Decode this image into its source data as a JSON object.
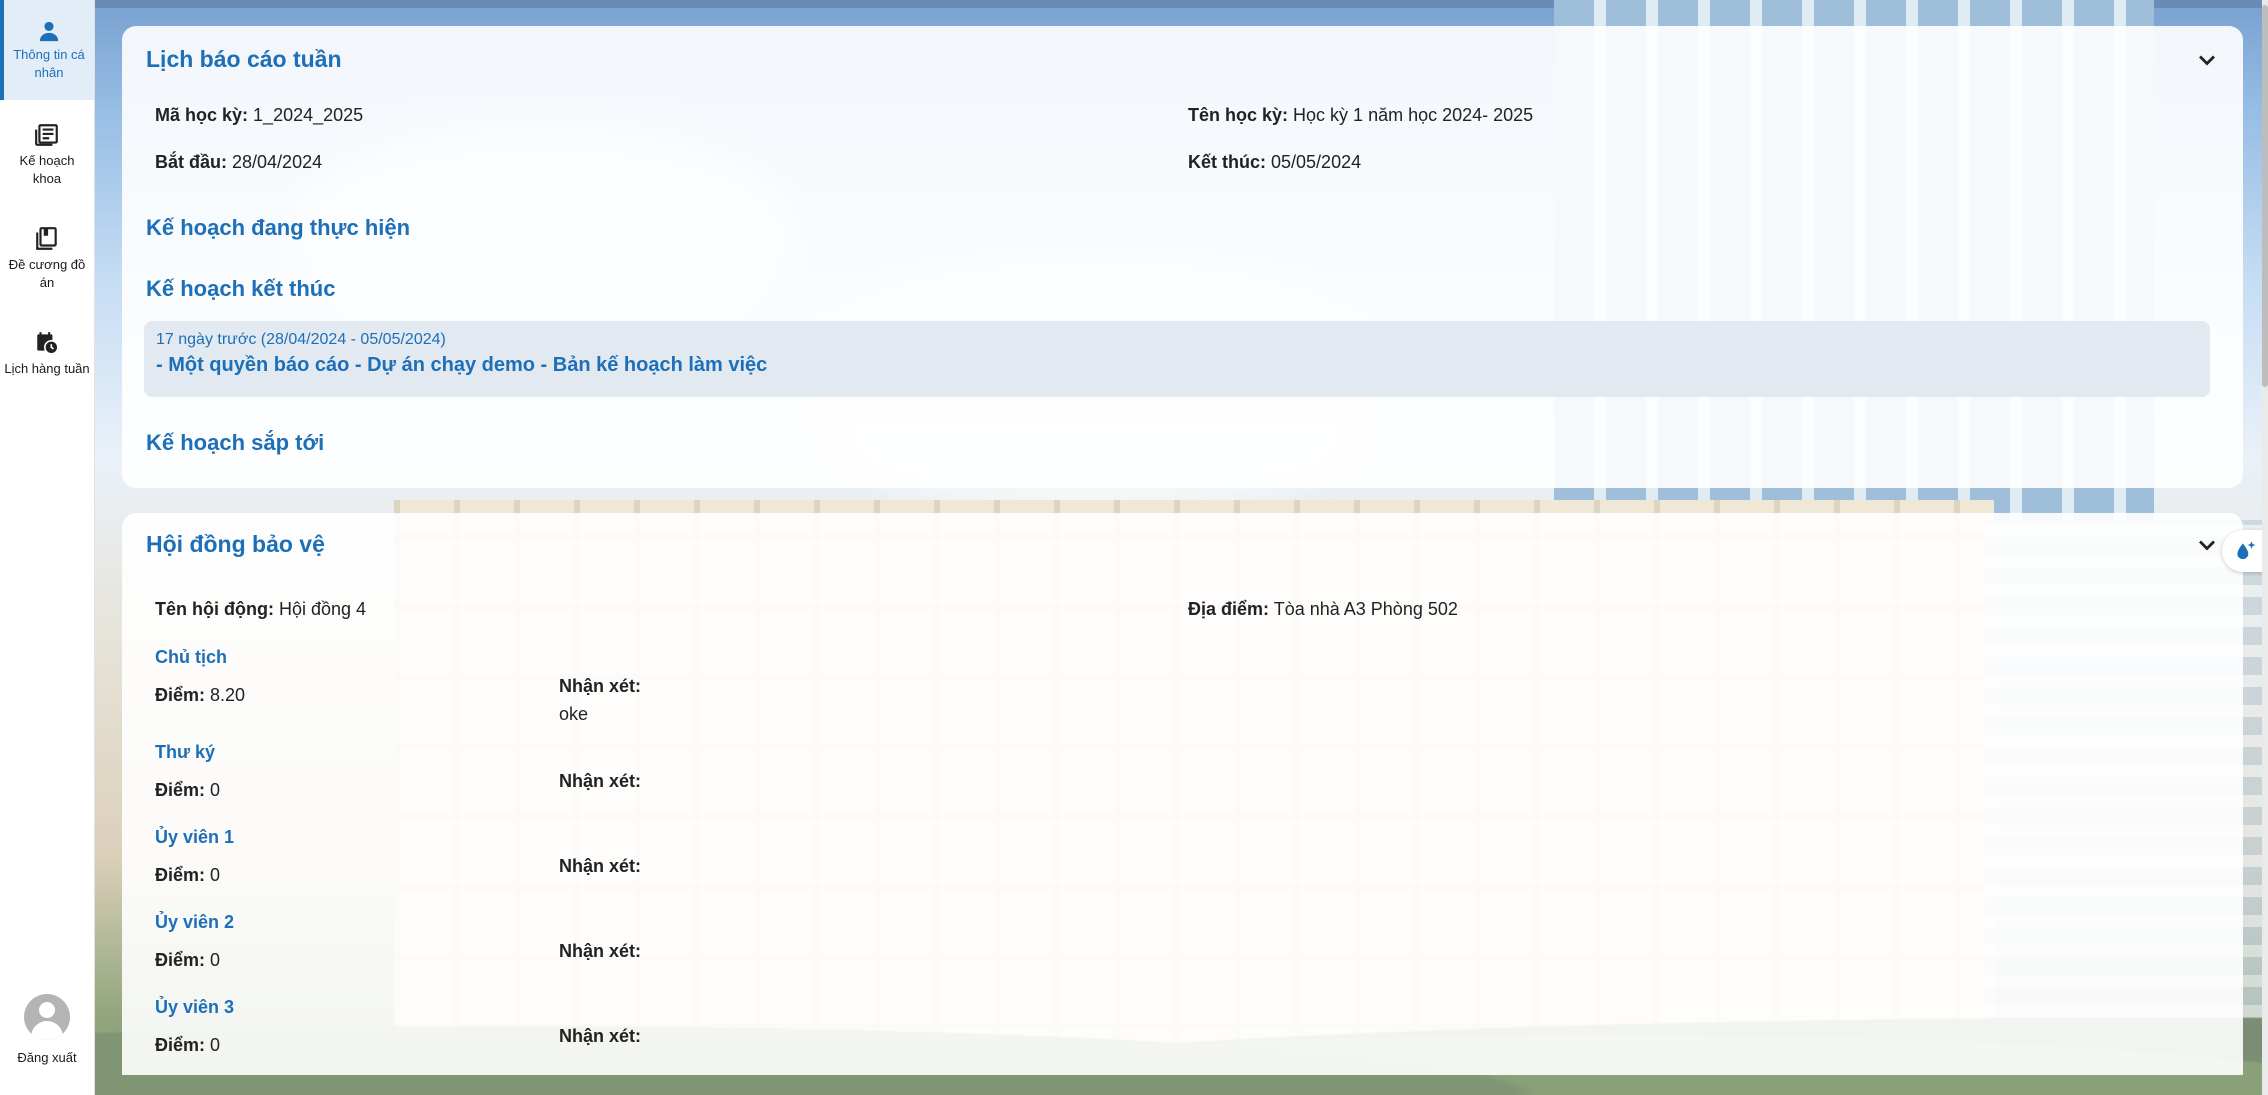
{
  "sidebar": {
    "items": [
      {
        "label": "Thông tin cá nhân",
        "icon": "person-icon",
        "active": true
      },
      {
        "label": "Kế hoạch khoa",
        "icon": "newspaper-icon",
        "active": false
      },
      {
        "label": "Đề cương đồ án",
        "icon": "book-icon",
        "active": false
      },
      {
        "label": "Lịch hàng tuần",
        "icon": "calendar-clock-icon",
        "active": false
      }
    ],
    "logout_label": "Đăng xuất"
  },
  "weekly": {
    "title": "Lịch báo cáo tuần",
    "semester_code_label": "Mã học kỳ:",
    "semester_code": "1_2024_2025",
    "semester_name_label": "Tên học kỳ:",
    "semester_name": "Học kỳ 1 năm học 2024- 2025",
    "start_label": "Bắt đầu:",
    "start": "28/04/2024",
    "end_label": "Kết thúc:",
    "end": "05/05/2024",
    "in_progress_heading": "Kế hoạch đang thực hiện",
    "finished_heading": "Kế hoạch kết thúc",
    "finished_items": [
      {
        "date": "17 ngày trước (28/04/2024 - 05/05/2024)",
        "text": "- Một quyền báo cáo - Dự án chạy demo - Bản kế hoạch làm việc"
      }
    ],
    "upcoming_heading": "Kế hoạch sắp tới"
  },
  "defense": {
    "title": "Hội đồng bảo vệ",
    "council_label": "Tên hội động:",
    "council": "Hội đồng 4",
    "location_label": "Địa điểm:",
    "location": "Tòa nhà A3 Phòng 502",
    "score_label": "Điểm:",
    "comment_label": "Nhận xét:",
    "members": [
      {
        "role": "Chủ tịch",
        "score": "8.20",
        "comment": "oke"
      },
      {
        "role": "Thư ký",
        "score": "0",
        "comment": ""
      },
      {
        "role": "Ủy viên 1",
        "score": "0",
        "comment": ""
      },
      {
        "role": "Ủy viên 2",
        "score": "0",
        "comment": ""
      },
      {
        "role": "Ủy viên 3",
        "score": "0",
        "comment": ""
      }
    ]
  },
  "colors": {
    "accent": "#1d6fb8",
    "plan_box": "#e2e8f0"
  }
}
